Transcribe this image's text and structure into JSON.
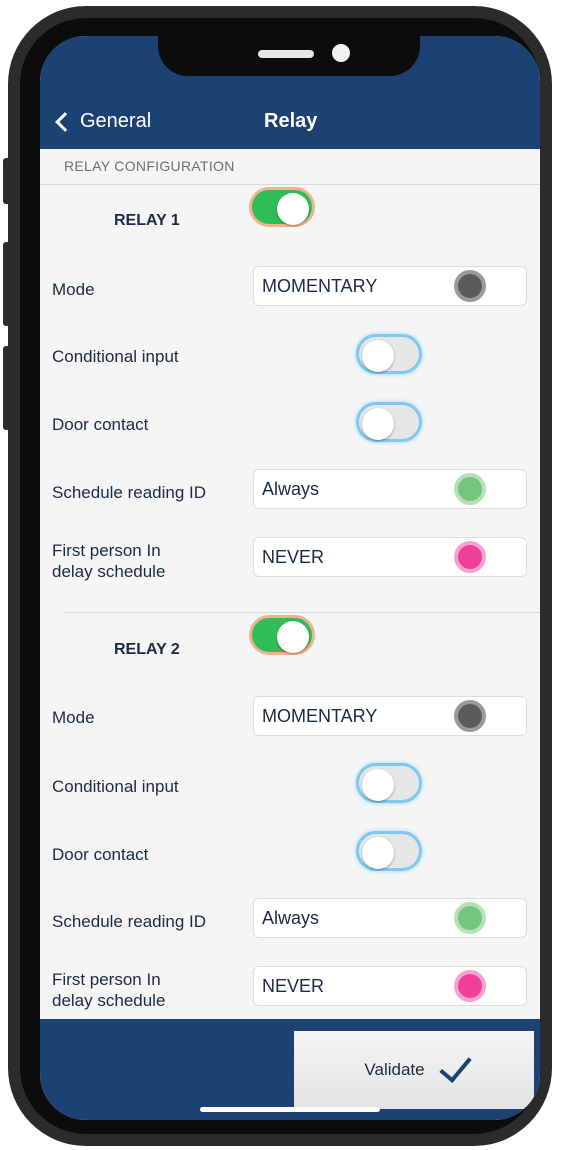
{
  "nav": {
    "back_label": "General",
    "title": "Relay"
  },
  "section_header": "RELAY CONFIGURATION",
  "relays": [
    {
      "title": "RELAY 1",
      "enabled": true,
      "mode_label": "Mode",
      "mode_value": "MOMENTARY",
      "conditional_input_label": "Conditional input",
      "conditional_input": false,
      "door_contact_label": "Door contact",
      "door_contact": false,
      "schedule_label": "Schedule reading ID",
      "schedule_value": "Always",
      "first_person_label_1": "First person In",
      "first_person_label_2": "delay schedule",
      "first_person_value": "NEVER"
    },
    {
      "title": "RELAY 2",
      "enabled": true,
      "mode_label": "Mode",
      "mode_value": "MOMENTARY",
      "conditional_input_label": "Conditional input",
      "conditional_input": false,
      "door_contact_label": "Door contact",
      "door_contact": false,
      "schedule_label": "Schedule reading ID",
      "schedule_value": "Always",
      "first_person_label_1": "First person In",
      "first_person_label_2": "delay schedule",
      "first_person_value": "NEVER"
    }
  ],
  "footer": {
    "validate_label": "Validate"
  },
  "colors": {
    "nav_bg": "#1c4274",
    "toggle_on": "#2fbe56",
    "mode_dot": "#5b5b5b",
    "schedule_dot": "#74c67e",
    "first_person_dot": "#ef3f9a"
  }
}
